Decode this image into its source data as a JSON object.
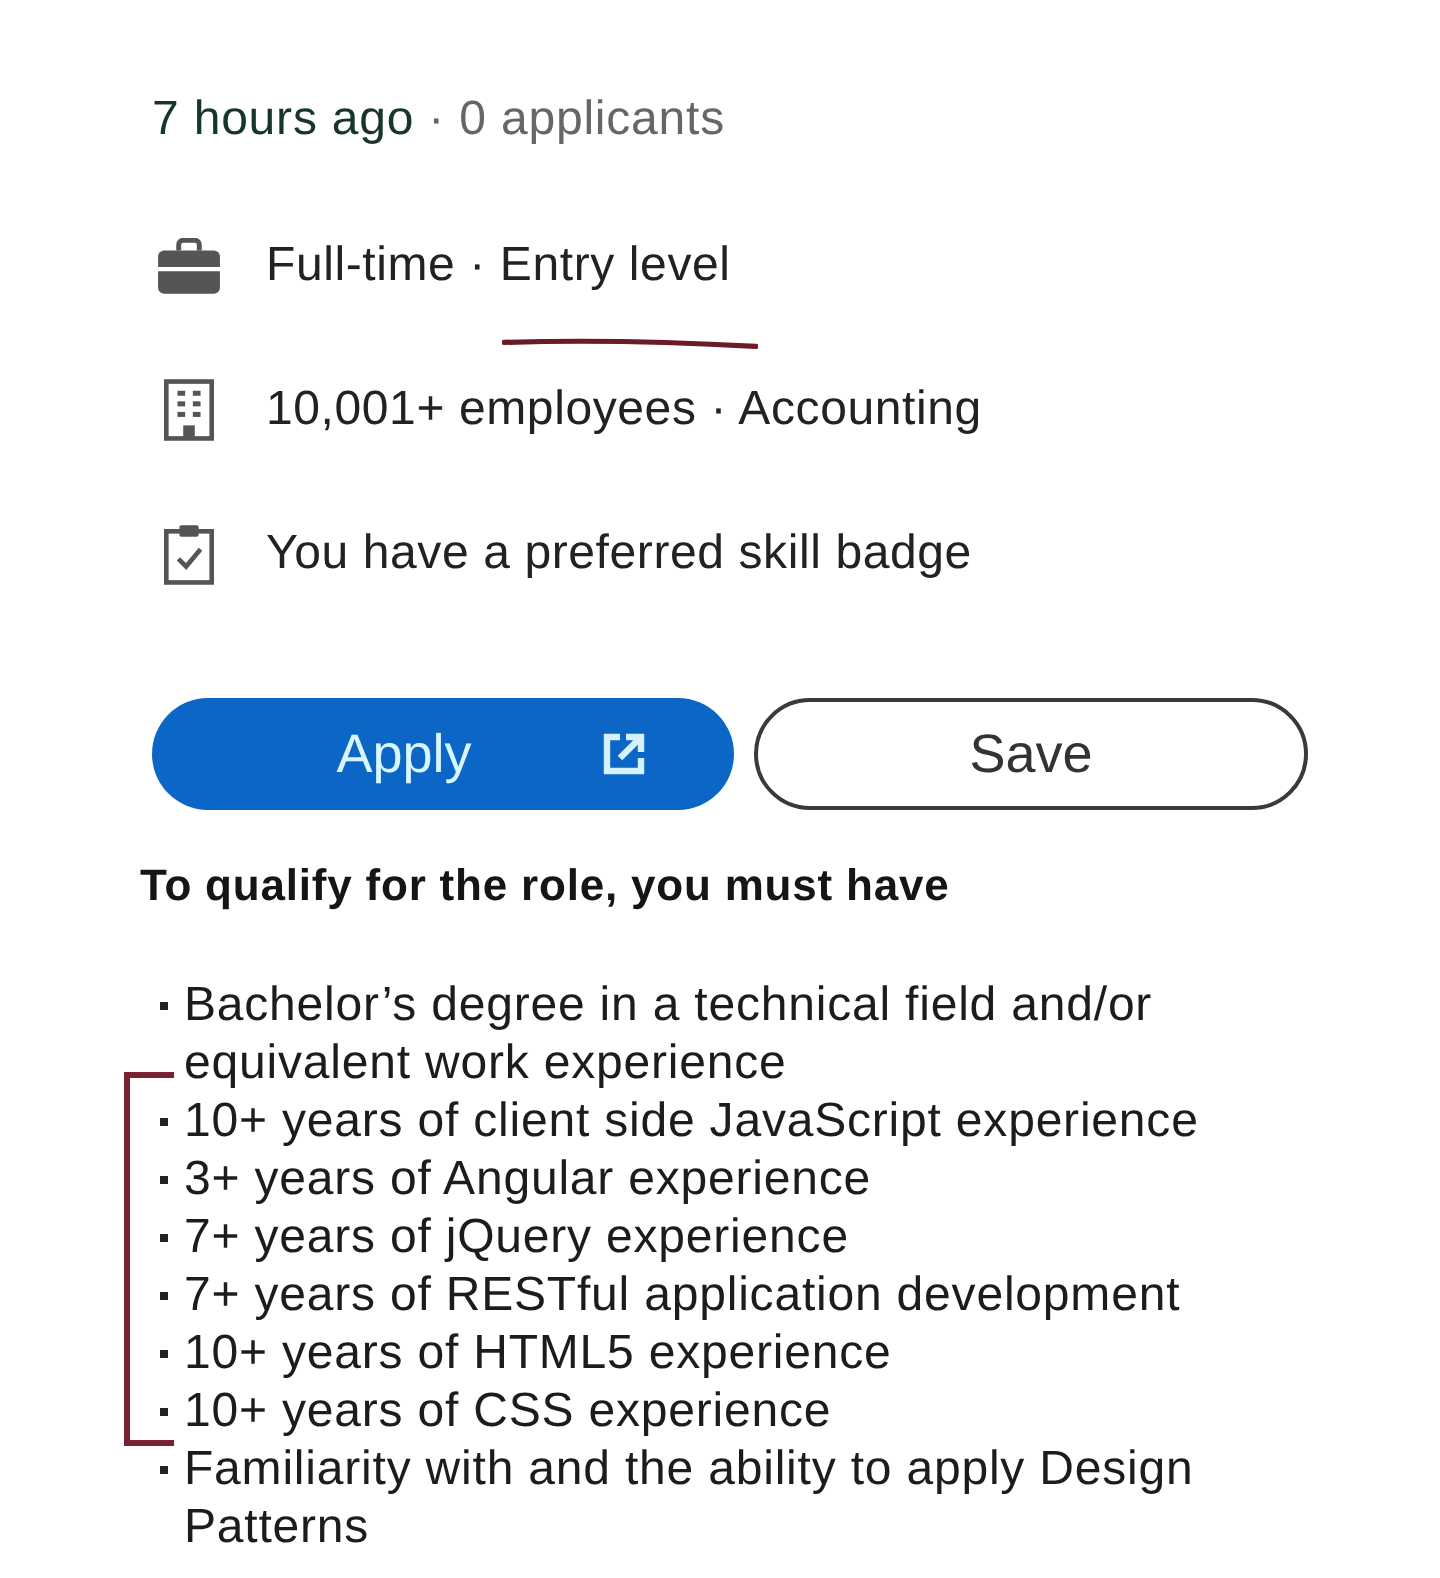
{
  "posted": {
    "time": "7 hours ago",
    "applicants": "· 0 applicants"
  },
  "details": [
    {
      "kind": "briefcase",
      "text": "Full-time · Entry level",
      "annotated": true
    },
    {
      "kind": "building",
      "text": "10,001+ employees · Accounting",
      "annotated": false
    },
    {
      "kind": "clipboard",
      "text": "You have a preferred skill badge",
      "annotated": false
    }
  ],
  "actions": [
    {
      "kind": "primary",
      "label": "Apply",
      "external": true
    },
    {
      "kind": "secondary",
      "label": "Save",
      "external": false
    }
  ],
  "requirements": {
    "heading": "To qualify for the role, you must have",
    "items": [
      {
        "text": "Bachelor’s degree in a technical field and/or equivalent work experience",
        "bracketed": false
      },
      {
        "text": "10+ years of client side JavaScript experience",
        "bracketed": true
      },
      {
        "text": "3+ years of Angular experience",
        "bracketed": true
      },
      {
        "text": "7+ years of jQuery experience",
        "bracketed": true
      },
      {
        "text": "7+ years of RESTful application development",
        "bracketed": true
      },
      {
        "text": "10+ years of HTML5 experience",
        "bracketed": true
      },
      {
        "text": "10+ years of CSS experience",
        "bracketed": true
      },
      {
        "text": "Familiarity with and the ability to apply Design Patterns",
        "bracketed": false
      }
    ]
  }
}
